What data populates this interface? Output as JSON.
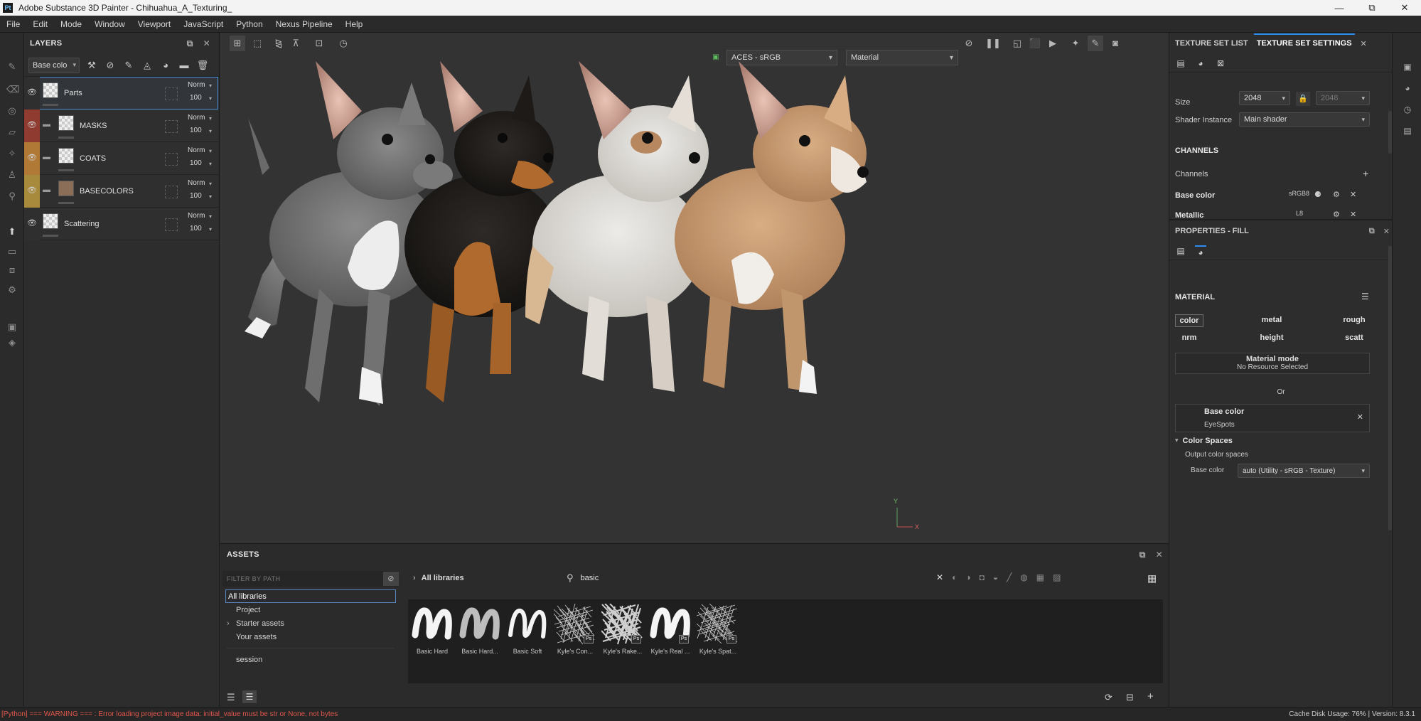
{
  "window": {
    "app_icon": "Pt",
    "title": "Adobe Substance 3D Painter - Chihuahua_A_Texturing_",
    "minimize": "—",
    "maximize": "⧉",
    "close": "✕"
  },
  "menu": [
    "File",
    "Edit",
    "Mode",
    "Window",
    "Viewport",
    "JavaScript",
    "Python",
    "Nexus Pipeline",
    "Help"
  ],
  "layers": {
    "title": "LAYERS",
    "channel_select": "Base colo",
    "items": [
      {
        "name": "Parts",
        "blend": "Norm",
        "opacity": "100",
        "color": "#2f2f2f",
        "is_folder": false,
        "thumb": "checker",
        "selected": true
      },
      {
        "name": "MASKS",
        "blend": "Norm",
        "opacity": "100",
        "color": "#8f3b30",
        "is_folder": true,
        "thumb": "checker"
      },
      {
        "name": "COATS",
        "blend": "Norm",
        "opacity": "100",
        "color": "#b07a36",
        "is_folder": true,
        "thumb": "checker"
      },
      {
        "name": "BASECOLORS",
        "blend": "Norm",
        "opacity": "100",
        "color": "#a88a3c",
        "is_folder": true,
        "thumb": "brown"
      },
      {
        "name": "Scattering",
        "blend": "Norm",
        "opacity": "100",
        "color": "#2f2f2f",
        "is_folder": false,
        "thumb": "checker"
      }
    ]
  },
  "viewport": {
    "color_transform": "ACES - sRGB",
    "display_mode": "Material",
    "axis_y": "Y",
    "axis_x": "X"
  },
  "texture_set": {
    "tab_list": "TEXTURE SET LIST",
    "tab_settings": "TEXTURE SET SETTINGS",
    "size_label": "Size",
    "size_value": "2048",
    "size_value_locked": "2048",
    "shader_label": "Shader Instance",
    "shader_value": "Main shader",
    "channels_title": "CHANNELS",
    "channels_label": "Channels",
    "channel_rows": [
      {
        "name": "Base color",
        "format": "sRGB8"
      },
      {
        "name": "Metallic",
        "format": "L8"
      }
    ]
  },
  "properties": {
    "title": "PROPERTIES - FILL",
    "material_title": "MATERIAL",
    "chips": [
      "color",
      "metal",
      "rough",
      "nrm",
      "height",
      "scatt"
    ],
    "material_mode_title": "Material mode",
    "material_mode_value": "No Resource Selected",
    "or_label": "Or",
    "base_color_title": "Base color",
    "base_color_resource": "EyeSpots",
    "color_spaces_title": "Color Spaces",
    "output_color_spaces": "Output color spaces",
    "base_color_label": "Base color",
    "base_color_space": "auto (Utility - sRGB - Texture)"
  },
  "assets": {
    "title": "ASSETS",
    "filter_placeholder": "FILTER BY PATH",
    "breadcrumb": "All libraries",
    "search_value": "basic",
    "tree": [
      "All libraries",
      "Project",
      "Starter assets",
      "Your assets",
      "session"
    ],
    "items": [
      {
        "label": "Basic Hard",
        "ps": false
      },
      {
        "label": "Basic Hard...",
        "ps": false
      },
      {
        "label": "Basic Soft",
        "ps": false
      },
      {
        "label": "Kyle's Con...",
        "ps": true
      },
      {
        "label": "Kyle's Rake...",
        "ps": true
      },
      {
        "label": "Kyle's Real ...",
        "ps": true
      },
      {
        "label": "Kyle's Spat...",
        "ps": true
      }
    ]
  },
  "status": {
    "error": "[Python] === WARNING === : Error loading project image data: initial_value must be str or None, not bytes",
    "right": "Cache Disk Usage:   76% | Version: 8.3.1"
  },
  "colors": {
    "accent": "#2d8cf0",
    "error": "#e0574b"
  }
}
